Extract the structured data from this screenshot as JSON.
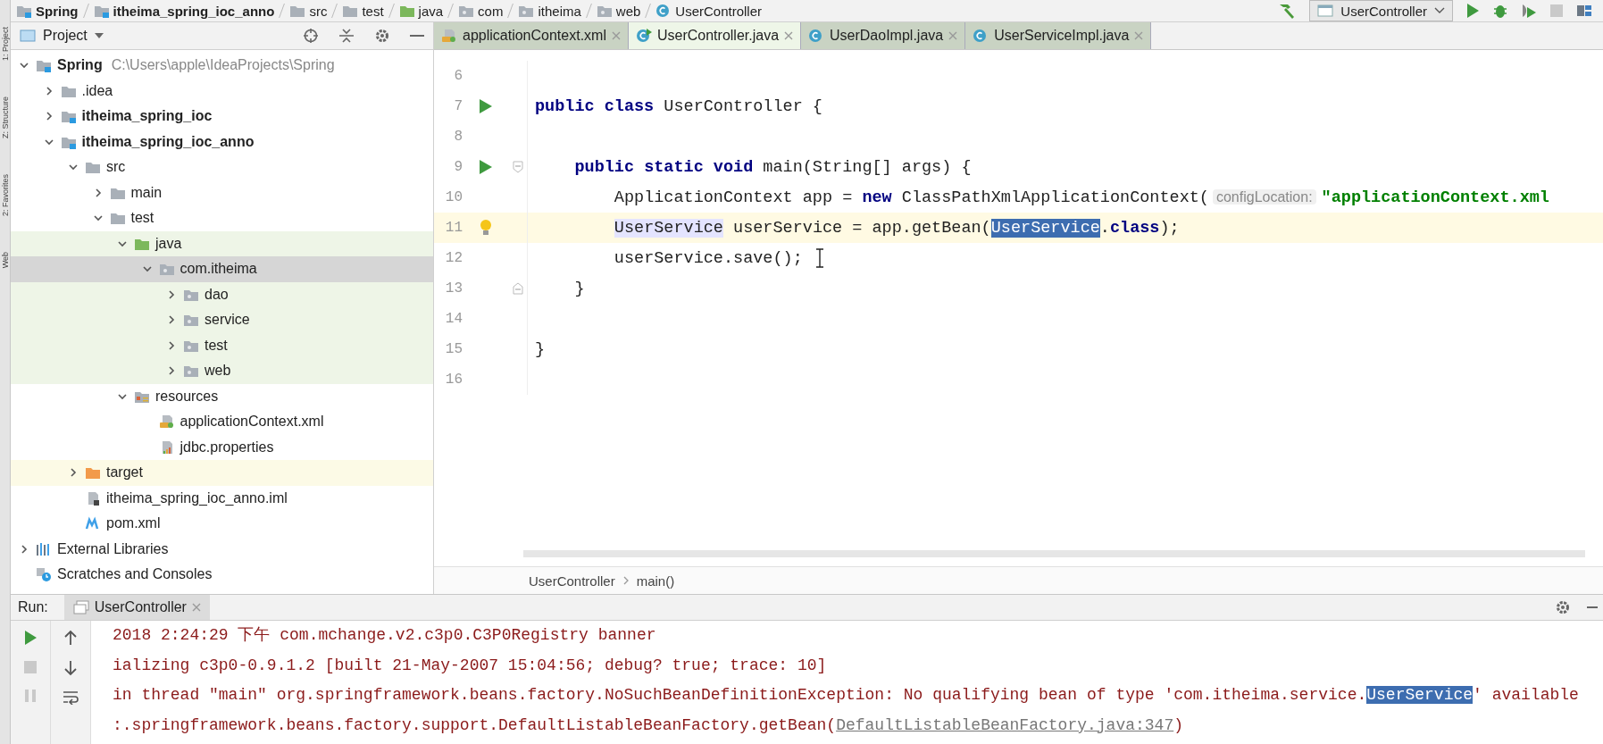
{
  "tool_stripe": [
    {
      "label": "1: Project"
    },
    {
      "label": "Z: Structure"
    },
    {
      "label": "2: Favorites"
    },
    {
      "label": "Web"
    }
  ],
  "breadcrumb": [
    {
      "label": "Spring",
      "kind": "module",
      "bold": true
    },
    {
      "label": "itheima_spring_ioc_anno",
      "kind": "module",
      "bold": true
    },
    {
      "label": "src",
      "kind": "folder",
      "bold": false
    },
    {
      "label": "test",
      "kind": "folder",
      "bold": false
    },
    {
      "label": "java",
      "kind": "source-root",
      "bold": false
    },
    {
      "label": "com",
      "kind": "package",
      "bold": false
    },
    {
      "label": "itheima",
      "kind": "package",
      "bold": false
    },
    {
      "label": "web",
      "kind": "package",
      "bold": false
    },
    {
      "label": "UserController",
      "kind": "class",
      "bold": false
    }
  ],
  "toolbar": {
    "run_config": "UserController"
  },
  "project_panel": {
    "title": "Project",
    "tree": [
      {
        "label": "Spring",
        "path": "C:\\Users\\apple\\IdeaProjects\\Spring",
        "kind": "module",
        "bold": true,
        "expanded": true,
        "selected": false,
        "children": [
          {
            "label": ".idea",
            "kind": "folder",
            "bold": false,
            "expanded": false,
            "selected": false
          },
          {
            "label": "itheima_spring_ioc",
            "kind": "module",
            "bold": true,
            "expanded": false,
            "selected": false
          },
          {
            "label": "itheima_spring_ioc_anno",
            "kind": "module",
            "bold": true,
            "expanded": true,
            "selected": false,
            "children": [
              {
                "label": "src",
                "kind": "folder",
                "bold": false,
                "expanded": true,
                "selected": false,
                "children": [
                  {
                    "label": "main",
                    "kind": "folder",
                    "bold": false,
                    "expanded": false,
                    "selected": false
                  },
                  {
                    "label": "test",
                    "kind": "folder",
                    "bold": false,
                    "expanded": true,
                    "selected": false,
                    "children": [
                      {
                        "label": "java",
                        "kind": "source-root",
                        "bold": false,
                        "expanded": true,
                        "selected": false,
                        "children": [
                          {
                            "label": "com.itheima",
                            "kind": "package",
                            "bold": false,
                            "expanded": true,
                            "selected": true,
                            "children": [
                              {
                                "label": "dao",
                                "kind": "package",
                                "bold": false,
                                "expanded": false,
                                "selected": false
                              },
                              {
                                "label": "service",
                                "kind": "package",
                                "bold": false,
                                "expanded": false,
                                "selected": false
                              },
                              {
                                "label": "test",
                                "kind": "package",
                                "bold": false,
                                "expanded": false,
                                "selected": false
                              },
                              {
                                "label": "web",
                                "kind": "package",
                                "bold": false,
                                "expanded": false,
                                "selected": false
                              }
                            ]
                          }
                        ]
                      },
                      {
                        "label": "resources",
                        "kind": "resources",
                        "bold": false,
                        "expanded": true,
                        "selected": false,
                        "children": [
                          {
                            "label": "applicationContext.xml",
                            "kind": "xml",
                            "bold": false,
                            "selected": false
                          },
                          {
                            "label": "jdbc.properties",
                            "kind": "properties",
                            "bold": false,
                            "selected": false
                          }
                        ]
                      }
                    ]
                  }
                ]
              },
              {
                "label": "target",
                "kind": "excluded",
                "bold": false,
                "expanded": false,
                "selected": false
              },
              {
                "label": "itheima_spring_ioc_anno.iml",
                "kind": "iml",
                "bold": false,
                "selected": false
              },
              {
                "label": "pom.xml",
                "kind": "maven",
                "bold": false,
                "selected": false
              }
            ]
          }
        ]
      },
      {
        "label": "External Libraries",
        "kind": "libraries",
        "bold": false,
        "expanded": false,
        "selected": false
      },
      {
        "label": "Scratches and Consoles",
        "kind": "scratches",
        "bold": false,
        "selected": false
      }
    ]
  },
  "editor": {
    "tabs": [
      {
        "label": "applicationContext.xml",
        "kind": "xml",
        "selected": false
      },
      {
        "label": "UserController.java",
        "kind": "runnable-class",
        "selected": true
      },
      {
        "label": "UserDaoImpl.java",
        "kind": "class",
        "selected": false
      },
      {
        "label": "UserServiceImpl.java",
        "kind": "class",
        "selected": false
      }
    ],
    "lines": [
      {
        "number": "6",
        "current": false
      },
      {
        "number": "7",
        "gutter": [
          {
            "kind": "run"
          }
        ],
        "current": false,
        "tokens": [
          {
            "kind": "keyword",
            "text": "public class "
          },
          {
            "kind": "plain",
            "text": "UserController {"
          }
        ]
      },
      {
        "number": "8",
        "current": false
      },
      {
        "number": "9",
        "gutter": [
          {
            "kind": "run"
          },
          {
            "kind": "fold"
          }
        ],
        "current": false,
        "tokens": [
          {
            "kind": "keyword",
            "text": "    public static void "
          },
          {
            "kind": "plain",
            "text": "main(String[] args) {"
          }
        ]
      },
      {
        "number": "10",
        "current": false,
        "tokens": [
          {
            "kind": "plain",
            "text": "        ApplicationContext app = "
          },
          {
            "kind": "keyword",
            "text": "new "
          },
          {
            "kind": "plain",
            "text": "ClassPathXmlApplicationContext("
          },
          {
            "kind": "hint",
            "text": "configLocation:"
          },
          {
            "kind": "string",
            "text": "\"applicationContext.xml"
          }
        ]
      },
      {
        "number": "11",
        "gutter": [
          {
            "kind": "bulb"
          }
        ],
        "current": true,
        "tokens": [
          {
            "kind": "occurrence",
            "text": "        UserService"
          },
          {
            "kind": "plain",
            "text": " userService = app.getBean("
          },
          {
            "kind": "selection",
            "text": "UserService"
          },
          {
            "kind": "plain",
            "text": "."
          },
          {
            "kind": "keyword",
            "text": "class"
          },
          {
            "kind": "plain",
            "text": ");"
          }
        ]
      },
      {
        "number": "12",
        "current": false,
        "tokens": [
          {
            "kind": "plain",
            "text": "        userService.save();"
          }
        ]
      },
      {
        "number": "13",
        "gutter": [
          {
            "kind": "fold-end"
          }
        ],
        "current": false,
        "tokens": [
          {
            "kind": "plain",
            "text": "    }"
          }
        ]
      },
      {
        "number": "14",
        "current": false
      },
      {
        "number": "15",
        "current": false,
        "tokens": [
          {
            "kind": "plain",
            "text": "}"
          }
        ]
      },
      {
        "number": "16",
        "current": false
      }
    ],
    "breadcrumb": [
      "UserController",
      "main()"
    ]
  },
  "run_panel": {
    "label": "Run:",
    "tab": "UserController",
    "console": [
      [
        {
          "kind": "plain",
          "text": "2018 2:24:29 下午 com.mchange.v2.c3p0.C3P0Registry banner"
        }
      ],
      [
        {
          "kind": "plain",
          "text": "ializing c3p0-0.9.1.2 [built 21-May-2007 15:04:56; debug? true; trace: 10]"
        }
      ],
      [
        {
          "kind": "plain",
          "text": "in thread \"main\" org.springframework.beans.factory.NoSuchBeanDefinitionException: No qualifying bean of type 'com.itheima.service."
        },
        {
          "kind": "selection",
          "text": "UserService"
        },
        {
          "kind": "plain",
          "text": "' available"
        }
      ],
      [
        {
          "kind": "plain",
          "text": ":.springframework.beans.factory.support.DefaultListableBeanFactory.getBean("
        },
        {
          "kind": "link",
          "text": "DefaultListableBeanFactory.java:347"
        },
        {
          "kind": "plain",
          "text": ")"
        }
      ]
    ]
  }
}
